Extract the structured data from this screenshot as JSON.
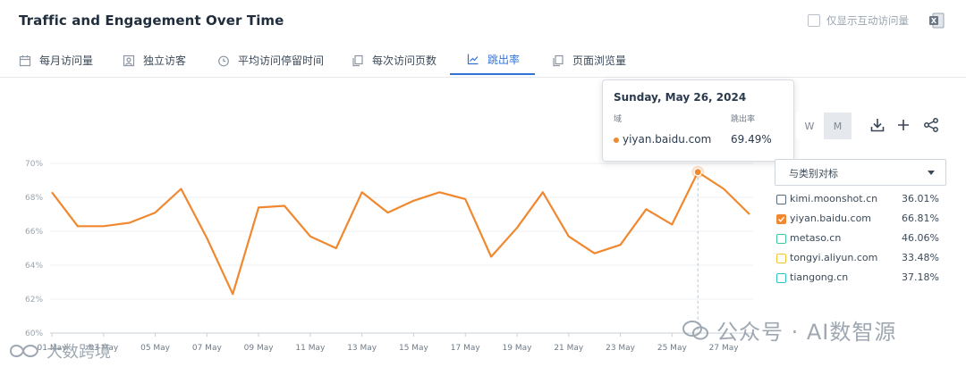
{
  "header": {
    "title": "Traffic and Engagement Over Time",
    "only_interactive_label": "仅显示互动访问量"
  },
  "tabs": [
    {
      "label": "每月访问量",
      "icon": "calendar-icon",
      "active": false
    },
    {
      "label": "独立访客",
      "icon": "user-icon",
      "active": false
    },
    {
      "label": "平均访问停留时间",
      "icon": "clock-icon",
      "active": false
    },
    {
      "label": "每次访问页数",
      "icon": "pages-icon",
      "active": false
    },
    {
      "label": "跳出率",
      "icon": "bounce-icon",
      "active": true
    },
    {
      "label": "页面浏览量",
      "icon": "pages-icon",
      "active": false
    }
  ],
  "tooltip": {
    "date": "Sunday, May 26, 2024",
    "col_domain": "域",
    "col_metric": "跳出率",
    "domain": "yiyan.baidu.com",
    "value": "69.49%"
  },
  "granularity": {
    "week": "W",
    "month": "M",
    "selected": "M"
  },
  "toolbar_icons": [
    "download-icon",
    "plus-icon",
    "share-icon"
  ],
  "compare": {
    "label": "与类别对标"
  },
  "legend": [
    {
      "name": "kimi.moonshot.cn",
      "pct": "36.01%",
      "color": "#5b6b7c",
      "checked": false
    },
    {
      "name": "yiyan.baidu.com",
      "pct": "66.81%",
      "color": "#f0882f",
      "checked": true
    },
    {
      "name": "metaso.cn",
      "pct": "46.06%",
      "color": "#3fc7a0",
      "checked": false
    },
    {
      "name": "tongyi.aliyun.com",
      "pct": "33.48%",
      "color": "#f2c431",
      "checked": false
    },
    {
      "name": "tiangong.cn",
      "pct": "37.18%",
      "color": "#2ec4c4",
      "checked": false
    }
  ],
  "watermark": {
    "right": "公众号 · AI数智源",
    "left": "大数跨境"
  },
  "chart_data": {
    "type": "line",
    "series": [
      {
        "name": "yiyan.baidu.com",
        "color": "#f0882f",
        "values": [
          68.3,
          66.3,
          66.3,
          66.5,
          67.1,
          68.5,
          65.6,
          62.3,
          67.4,
          67.5,
          65.7,
          65.0,
          68.3,
          67.1,
          67.8,
          68.3,
          67.9,
          64.5,
          66.2,
          68.3,
          65.7,
          64.7,
          65.2,
          67.3,
          66.4,
          69.49,
          68.5,
          67.0
        ]
      }
    ],
    "x_labels": [
      "01 May",
      "03 May",
      "05 May",
      "07 May",
      "09 May",
      "11 May",
      "13 May",
      "15 May",
      "17 May",
      "19 May",
      "21 May",
      "23 May",
      "25 May",
      "27 May"
    ],
    "y_ticks": [
      "60%",
      "62%",
      "64%",
      "66%",
      "68%",
      "70%"
    ],
    "ylim": [
      60,
      70
    ],
    "highlight_index": 25,
    "grid": true
  }
}
